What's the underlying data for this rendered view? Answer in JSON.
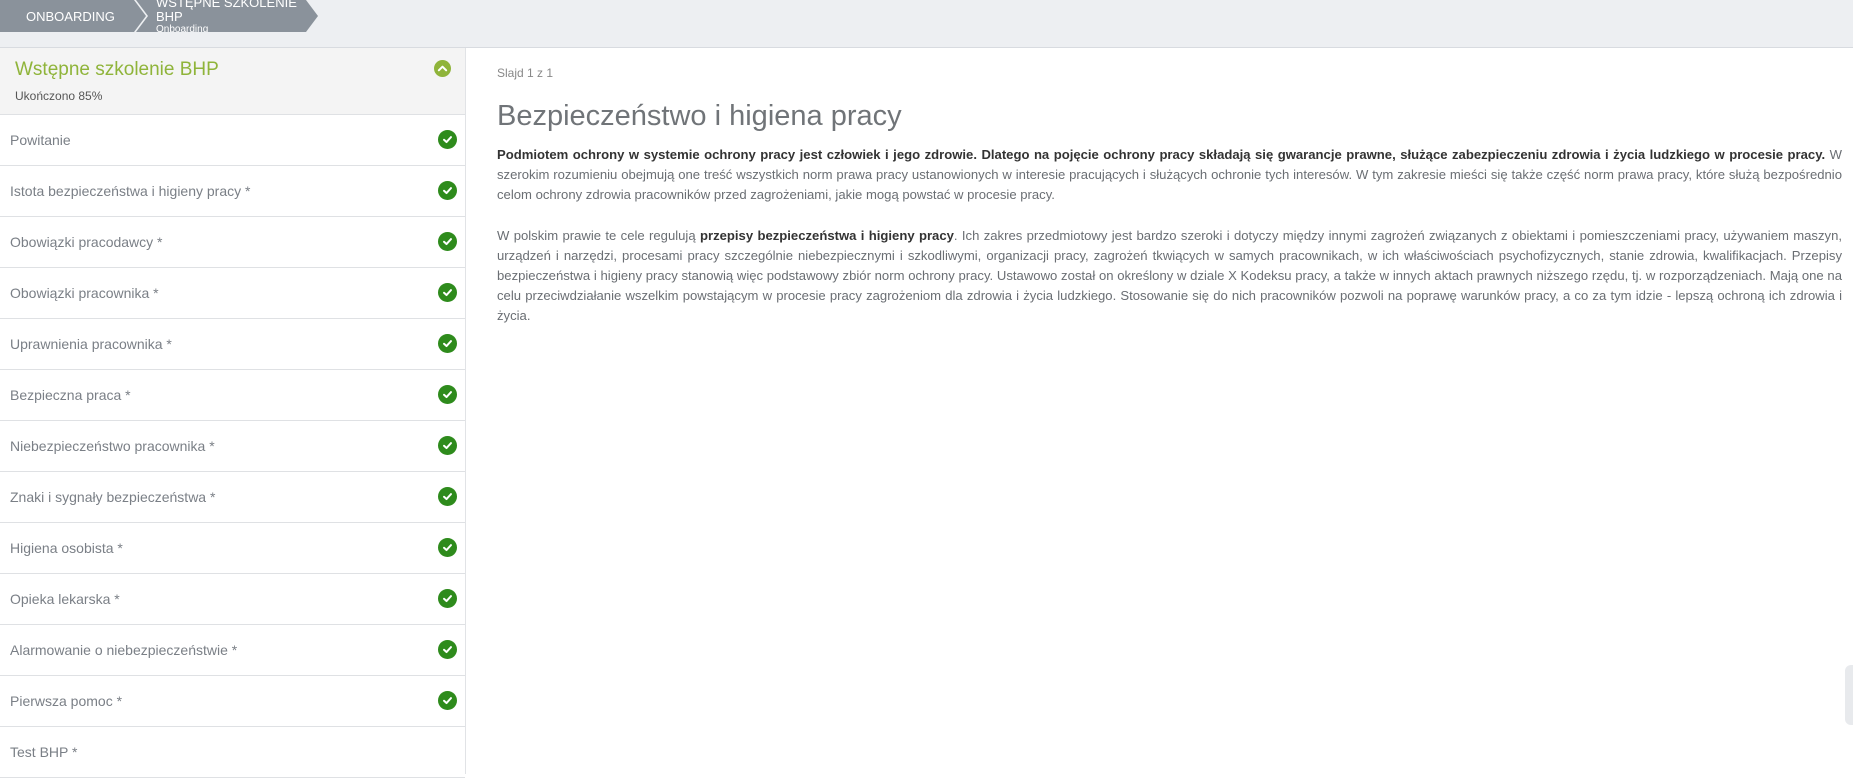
{
  "breadcrumb": {
    "items": [
      {
        "label": "ONBOARDING"
      },
      {
        "label": "WSTĘPNE SZKOLENIE BHP",
        "sub": "Onboarding"
      }
    ]
  },
  "sidebar": {
    "title": "Wstępne szkolenie BHP",
    "progress": "Ukończono 85%",
    "items": [
      {
        "label": "Powitanie",
        "done": true
      },
      {
        "label": "Istota bezpieczeństwa i higieny pracy *",
        "done": true
      },
      {
        "label": "Obowiązki pracodawcy *",
        "done": true
      },
      {
        "label": "Obowiązki pracownika *",
        "done": true
      },
      {
        "label": "Uprawnienia pracownika *",
        "done": true
      },
      {
        "label": "Bezpieczna praca *",
        "done": true
      },
      {
        "label": "Niebezpieczeństwo pracownika *",
        "done": true
      },
      {
        "label": "Znaki i sygnały bezpieczeństwa *",
        "done": true
      },
      {
        "label": "Higiena osobista *",
        "done": true
      },
      {
        "label": "Opieka lekarska *",
        "done": true
      },
      {
        "label": "Alarmowanie o niebezpieczeństwie *",
        "done": true
      },
      {
        "label": "Pierwsza pomoc *",
        "done": true
      },
      {
        "label": "Test BHP *",
        "done": false
      }
    ]
  },
  "main": {
    "slide_counter": "Slajd 1 z 1",
    "heading": "Bezpieczeństwo i higiena pracy",
    "p1_bold": "Podmiotem ochrony w systemie ochrony pracy jest człowiek i jego zdrowie. Dlatego na pojęcie ochrony pracy składają się gwarancje prawne, służące zabezpieczeniu zdrowia i życia ludzkiego w procesie pracy.",
    "p1_rest": " W szerokim rozumieniu obejmują one treść wszystkich norm prawa pracy ustanowionych w interesie pracujących i służących ochronie tych interesów. W tym zakresie mieści się także część norm prawa pracy, które służą bezpośrednio celom ochrony zdrowia pracowników przed zagrożeniami, jakie mogą powstać w procesie pracy.",
    "p2_start": "W polskim prawie te cele regulują ",
    "p2_bold": "przepisy bezpieczeństwa i higieny pracy",
    "p2_rest": ". Ich zakres przedmiotowy jest bardzo szeroki i dotyczy między innymi zagrożeń związanych z obiektami i pomieszczeniami pracy, używaniem maszyn, urządzeń i narzędzi, procesami pracy szczególnie niebezpiecznymi i szkodliwymi, organizacji pracy, zagrożeń tkwiących w samych pracownikach, w ich właściwościach psychofizycznych, stanie zdrowia, kwalifikacjach. Przepisy bezpieczeństwa i higieny pracy stanowią więc podstawowy zbiór norm ochrony pracy. Ustawowo został on określony w dziale X Kodeksu pracy, a także w innych aktach prawnych niższego rzędu, tj. w rozporządzeniach. Mają one na celu przeciwdziałanie wszelkim powstającym w procesie pracy zagrożeniom dla zdrowia i życia ludzkiego. Stosowanie się do nich pracowników pozwoli na poprawę warunków pracy, a co za tym idzie - lepszą ochroną ich zdrowia i życia."
  },
  "colors": {
    "accent_green": "#8fb43a",
    "check_green": "#2e8b1c",
    "breadcrumb_gray": "#8a929b"
  }
}
